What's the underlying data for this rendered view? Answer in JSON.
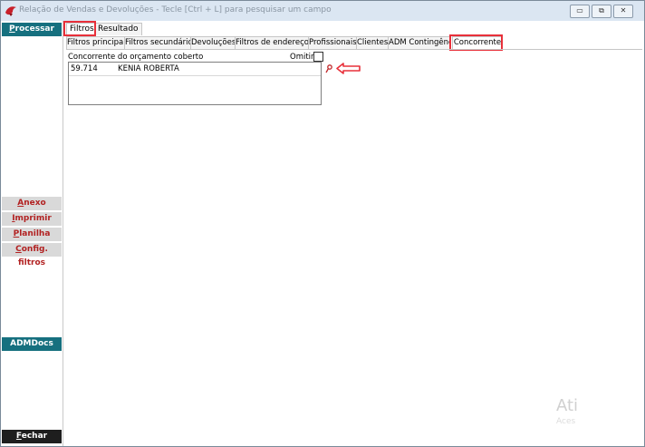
{
  "window": {
    "title": "Relação de Vendas e Devoluções - Tecle [Ctrl + L] para pesquisar um campo",
    "controls": [
      "▭",
      "⧉",
      "✕"
    ]
  },
  "sidebar": {
    "processar": {
      "key": "P",
      "rest": "rocessar"
    },
    "anexo": {
      "key": "A",
      "rest": "nexo"
    },
    "imprimir": {
      "key": "I",
      "rest": "mprimir"
    },
    "planilha": {
      "key": "P",
      "rest": "lanilha"
    },
    "config": {
      "key": "C",
      "rest": "onfig. filtros"
    },
    "admdocs": "ADMDocs",
    "fechar": {
      "key": "F",
      "rest": "echar"
    }
  },
  "tabs": [
    {
      "label": "Filtros",
      "selected": true
    },
    {
      "label": "Resultado",
      "selected": false
    }
  ],
  "subtabs": [
    {
      "label": "Filtros principais"
    },
    {
      "label": "Filtros secundários"
    },
    {
      "label": "Devoluções"
    },
    {
      "label": "Filtros de endereços"
    },
    {
      "label": "Profissionais"
    },
    {
      "label": "Clientes"
    },
    {
      "label": "ADM Contingência"
    },
    {
      "label": "Concorrente",
      "selected": true
    }
  ],
  "panel": {
    "field_label": "Concorrente do orçamento coberto",
    "omit_label": "Omitir",
    "omit_checked": false,
    "rows": [
      {
        "code": "59.714",
        "name": "KENIA ROBERTA"
      }
    ]
  },
  "watermark": {
    "line1": "Ati",
    "line2": "Aces"
  },
  "colors": {
    "teal": "#16707f",
    "highlight": "#e8303a",
    "sidebar_red": "#b22222"
  },
  "icons": {
    "key": "key-icon",
    "arrow": "arrow-left-icon",
    "app": "bird-logo-icon"
  }
}
